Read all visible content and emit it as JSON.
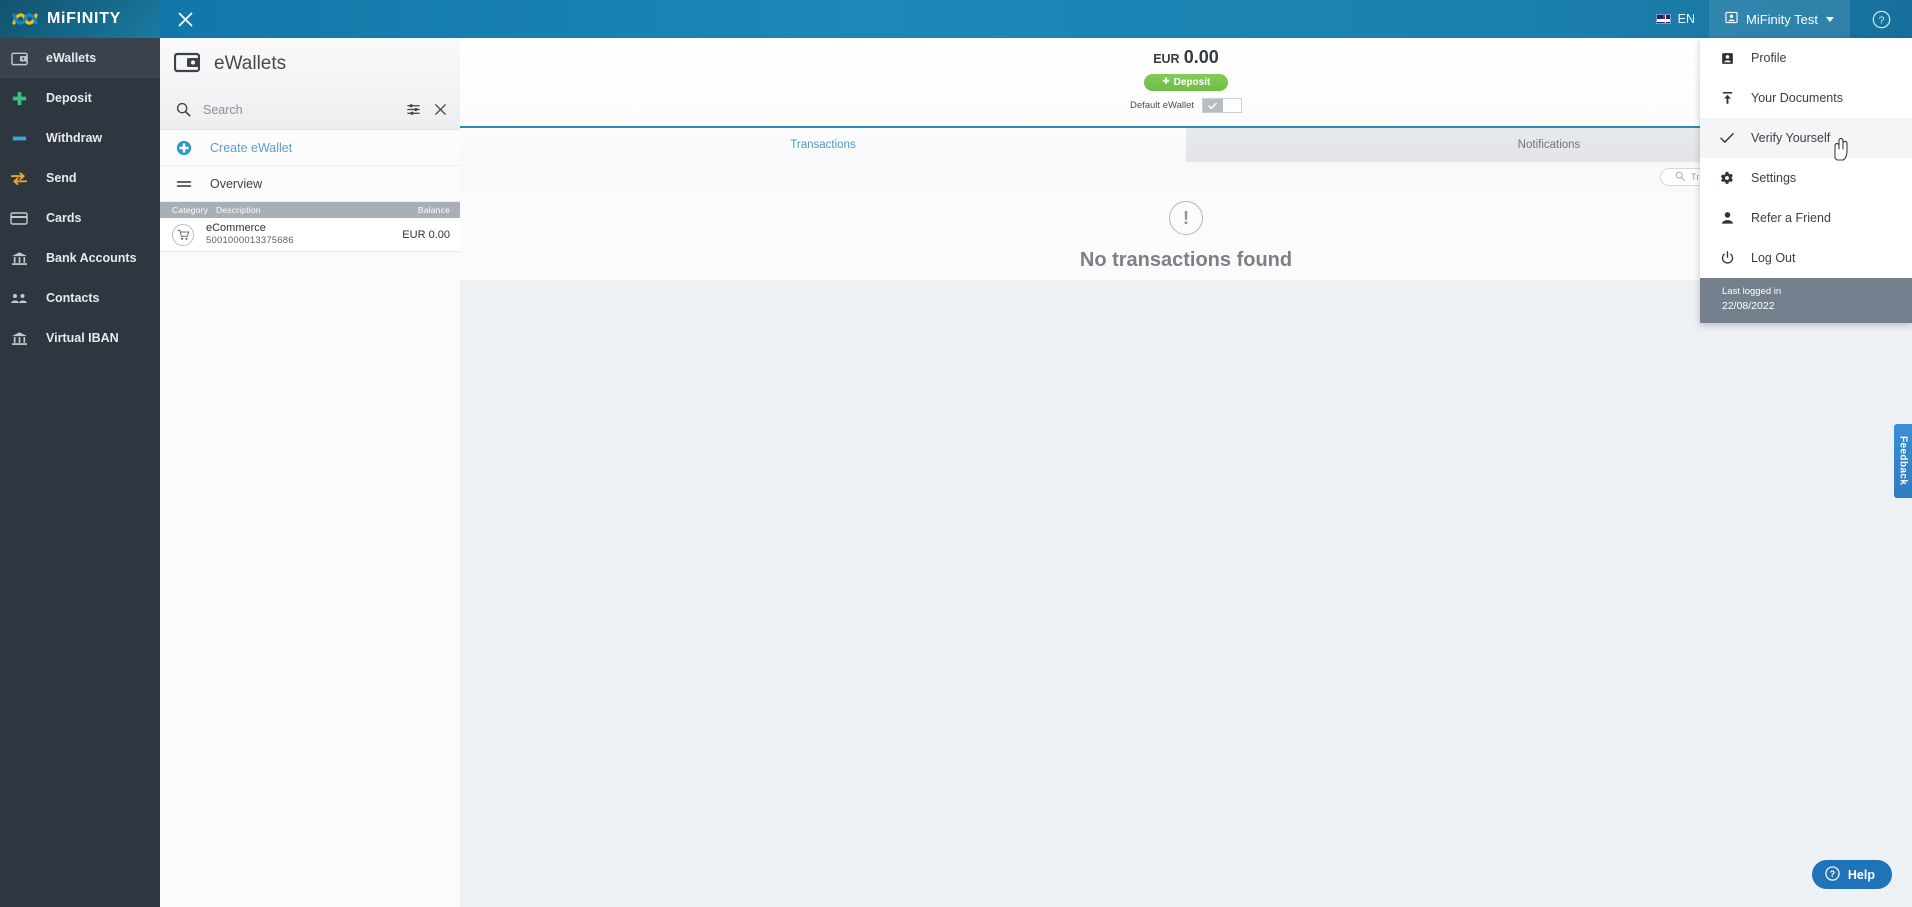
{
  "brand": {
    "name": "MiFINITY",
    "logo_icon": "mifinity-logo-icon"
  },
  "header": {
    "close_icon": "close-icon",
    "language": {
      "code": "EN",
      "flag_icon": "uk-flag-icon"
    },
    "user": {
      "label": "MiFinity Test",
      "icon": "user-card-icon",
      "caret_icon": "chevron-down-icon"
    },
    "help_icon": "help-circle-icon"
  },
  "sidebar": {
    "items": [
      {
        "label": "eWallets",
        "icon": "wallet-icon",
        "active": true
      },
      {
        "label": "Deposit",
        "icon": "plus-icon",
        "active": false
      },
      {
        "label": "Withdraw",
        "icon": "minus-icon",
        "active": false
      },
      {
        "label": "Send",
        "icon": "transfer-arrows-icon",
        "active": false
      },
      {
        "label": "Cards",
        "icon": "card-icon",
        "active": false
      },
      {
        "label": "Bank Accounts",
        "icon": "bank-icon",
        "active": false
      },
      {
        "label": "Contacts",
        "icon": "contacts-icon",
        "active": false
      },
      {
        "label": "Virtual IBAN",
        "icon": "bank-icon",
        "active": false
      }
    ]
  },
  "panel": {
    "title": "eWallets",
    "title_icon": "wallet-icon",
    "search": {
      "placeholder": "Search",
      "value": "",
      "search_icon": "search-icon",
      "filter_icon": "tune-filter-icon",
      "clear_icon": "close-icon"
    },
    "actions": [
      {
        "label": "Create eWallet",
        "icon": "plus-circle-icon",
        "style": "link"
      },
      {
        "label": "Overview",
        "icon": "list-menu-icon",
        "style": "plain"
      }
    ],
    "list_headers": {
      "category": "Category",
      "description": "Description",
      "balance": "Balance"
    },
    "wallets": [
      {
        "icon": "shopping-cart-icon",
        "name": "eCommerce",
        "number": "5001000013375686",
        "balance": "EUR 0.00"
      }
    ]
  },
  "main": {
    "summary": {
      "currency": "EUR",
      "amount": "0.00",
      "deposit_label": "Deposit",
      "deposit_icon": "plus-icon",
      "default_label": "Default eWallet",
      "toggle_on_icon": "check-icon",
      "toggle_state": "on"
    },
    "tabs": [
      {
        "label": "Transactions",
        "active": true
      },
      {
        "label": "Notifications",
        "active": false
      }
    ],
    "transaction_search": {
      "placeholder": "Transaction Search",
      "value": "",
      "icon": "search-icon"
    },
    "empty_state": {
      "icon": "exclamation-circle-icon",
      "symbol": "!",
      "message": "No transactions found"
    }
  },
  "user_dropdown": {
    "items": [
      {
        "label": "Profile",
        "icon": "user-card-icon",
        "hover": false
      },
      {
        "label": "Your Documents",
        "icon": "upload-icon",
        "hover": false
      },
      {
        "label": "Verify Yourself",
        "icon": "check-icon",
        "hover": true
      },
      {
        "label": "Settings",
        "icon": "gear-icon",
        "hover": false
      },
      {
        "label": "Refer a Friend",
        "icon": "person-icon",
        "hover": false
      },
      {
        "label": "Log Out",
        "icon": "power-icon",
        "hover": false
      }
    ],
    "footer": {
      "label": "Last logged in",
      "date": "22/08/2022"
    }
  },
  "feedback_tab": {
    "label": "Feedback"
  },
  "help_button": {
    "label": "Help",
    "icon": "question-circle-icon"
  },
  "colors": {
    "brand_blue": "#1277a8",
    "sidebar_bg": "#2e3640",
    "accent_link": "#5f9cc4",
    "deposit_green": "#6cbd46",
    "tab_active": "#4f9ac2",
    "footer_slate": "#74808e",
    "feedback_blue": "#2f7cbd",
    "help_blue": "#1f73b8"
  }
}
